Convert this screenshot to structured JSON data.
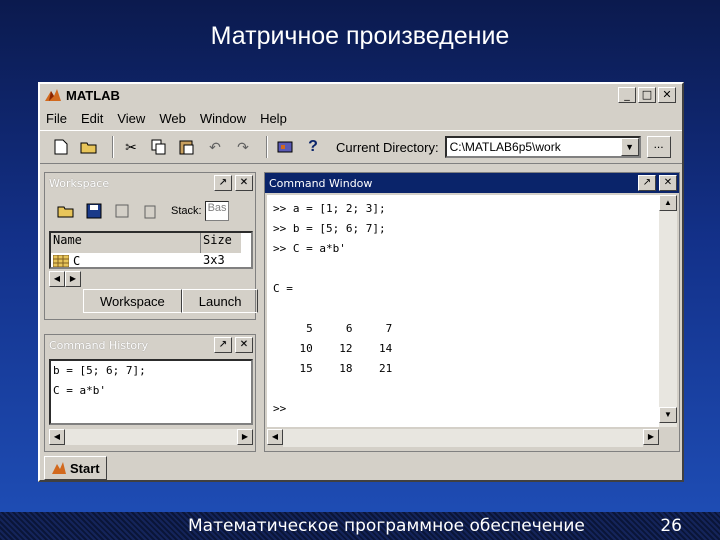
{
  "slide": {
    "title": "Матричное произведение",
    "footer": "Математическое программное обеспечение",
    "page_number": "26"
  },
  "window": {
    "title": "MATLAB",
    "minimize": "_",
    "maximize": "□",
    "close": "✕"
  },
  "menu": [
    "File",
    "Edit",
    "View",
    "Web",
    "Window",
    "Help"
  ],
  "toolbar": {
    "help": "?",
    "current_directory_label": "Current Directory:",
    "current_directory": "C:\\MATLAB6p5\\work",
    "browse": "..."
  },
  "workspace": {
    "title": "Workspace",
    "stack_label": "Stack:",
    "stack_value": "Bas",
    "columns": [
      "Name",
      "Size"
    ],
    "rows": [
      {
        "name": "C",
        "size": "3x3"
      }
    ],
    "tabs": [
      "Workspace",
      "Launch"
    ]
  },
  "command_history": {
    "title": "Command History",
    "lines": [
      "b = [5; 6; 7];",
      "C = a*b'"
    ]
  },
  "command_window": {
    "title": "Command Window",
    "lines": [
      ">> a = [1; 2; 3];",
      ">> b = [5; 6; 7];",
      ">> C = a*b'",
      "",
      "C =",
      "",
      "     5     6     7",
      "    10    12    14",
      "    15    18    21",
      "",
      ">>"
    ]
  },
  "start": {
    "label": "Start"
  }
}
